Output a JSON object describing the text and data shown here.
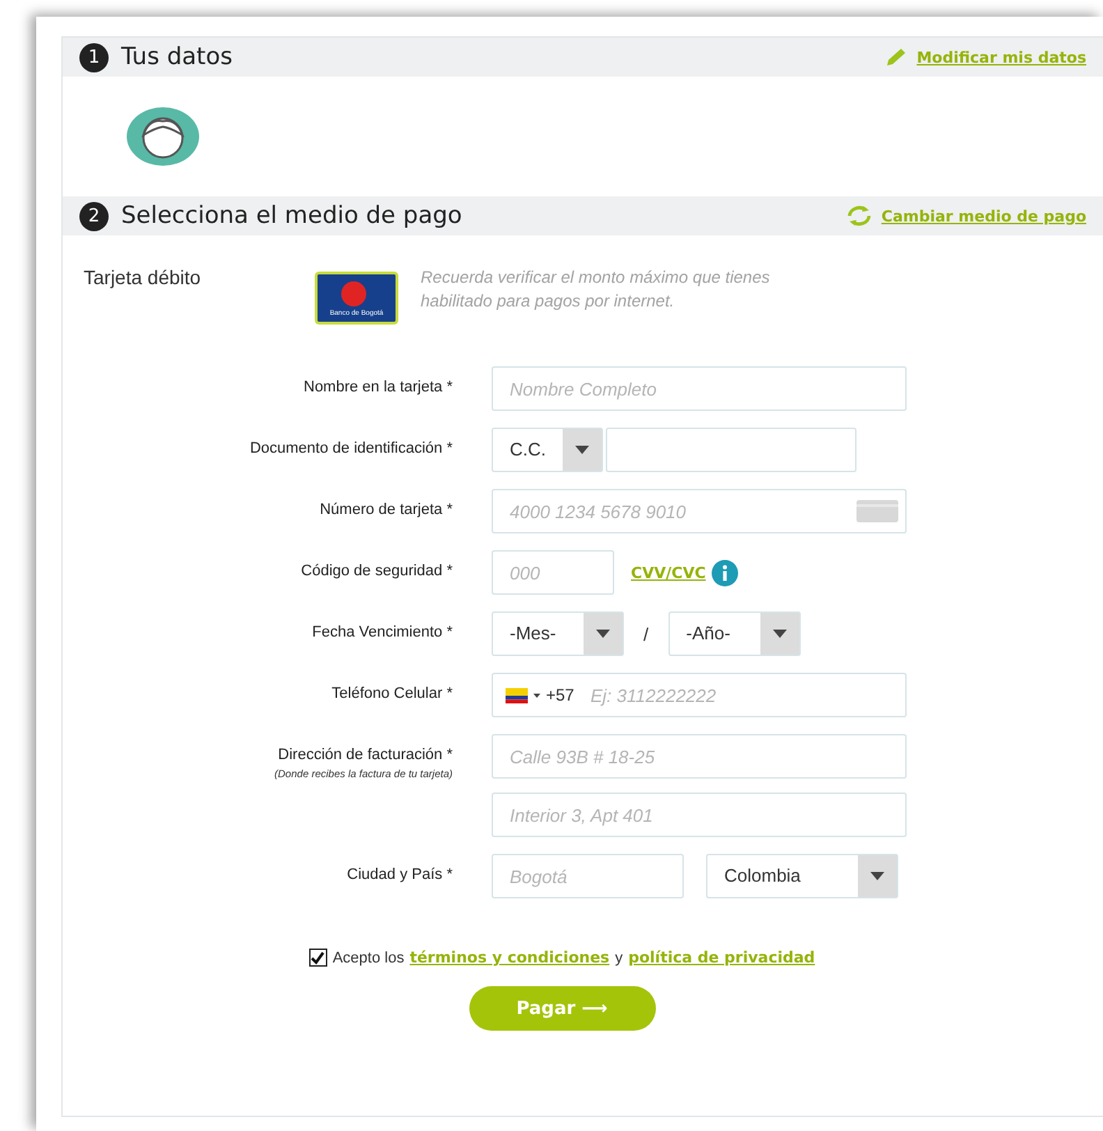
{
  "sections": [
    {
      "number": "1",
      "title": "Tus datos",
      "action": {
        "kind": "edit",
        "label": "Modificar mis datos"
      }
    },
    {
      "number": "2",
      "title": "Selecciona el medio de pago",
      "action": {
        "kind": "change",
        "label": "Cambiar medio de pago"
      }
    }
  ],
  "payment": {
    "method": "Tarjeta débito",
    "bank": "Banco de Bogotá",
    "note": "Recuerda verificar el monto máximo que tienes habilitado para pagos por internet."
  },
  "form": [
    {
      "kind": "single",
      "label": "Nombre en la tarjeta *",
      "fields": [
        {
          "kind": "input",
          "placeholder": "Nombre Completo"
        }
      ]
    },
    {
      "kind": "document",
      "label": "Documento de identificación *",
      "fields": [
        {
          "kind": "select",
          "value": "C.C."
        },
        {
          "kind": "input"
        }
      ]
    },
    {
      "kind": "single",
      "label": "Número de tarjeta *",
      "fields": [
        {
          "kind": "card",
          "placeholder": "4000 1234 5678 9010"
        }
      ]
    },
    {
      "kind": "security",
      "label": "Código de seguridad *",
      "fields": [
        {
          "kind": "input",
          "placeholder": "000"
        },
        {
          "kind": "link",
          "label": "CVV/CVC"
        }
      ]
    },
    {
      "kind": "expiry",
      "label": "Fecha Vencimiento *",
      "fields": [
        {
          "kind": "select",
          "value": "-Mes-"
        },
        {
          "kind": "separator",
          "label": "/"
        },
        {
          "kind": "select",
          "value": "-Año-"
        }
      ]
    },
    {
      "kind": "single",
      "label": "Teléfono Celular *",
      "fields": [
        {
          "kind": "phone",
          "code": "+57",
          "placeholder": "Ej: 3112222222"
        }
      ]
    },
    {
      "kind": "address",
      "label": "Dirección de facturación *",
      "sublabel": "(Donde recibes la factura de tu tarjeta)",
      "fields": [
        {
          "kind": "input",
          "placeholder": "Calle 93B # 18-25"
        },
        {
          "kind": "input",
          "placeholder": "Interior 3, Apt 401"
        }
      ]
    },
    {
      "kind": "city",
      "label": "Ciudad y País *",
      "fields": [
        {
          "kind": "input",
          "placeholder": "Bogotá"
        },
        {
          "kind": "select",
          "value": "Colombia"
        }
      ]
    }
  ],
  "terms": {
    "checked": true,
    "prefix": "Acepto los",
    "link1": "términos y condiciones",
    "joiner": "y",
    "link2": "política de privacidad"
  },
  "submit": {
    "label": "Pagar",
    "arrow": "⟶"
  }
}
